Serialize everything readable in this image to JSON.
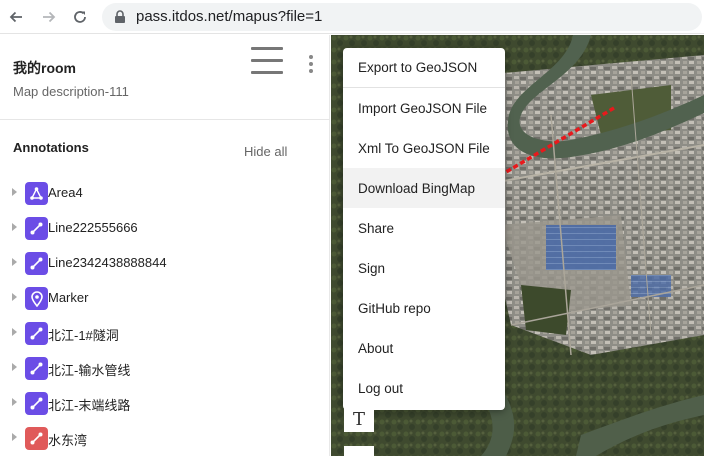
{
  "browser": {
    "url": "pass.itdos.net/mapus?file=1"
  },
  "project": {
    "title": "我的room",
    "description": "Map description-111"
  },
  "annotations": {
    "heading": "Annotations",
    "hide_all_label": "Hide all",
    "items": [
      {
        "label": "Area4",
        "type": "area",
        "color": "#6b4de6"
      },
      {
        "label": "Line222555666",
        "type": "line",
        "color": "#6b4de6"
      },
      {
        "label": "Line2342438888844",
        "type": "line",
        "color": "#6b4de6"
      },
      {
        "label": "Marker",
        "type": "marker",
        "color": "#6b4de6"
      },
      {
        "label": "北江-1#隧洞",
        "type": "line",
        "color": "#6b4de6"
      },
      {
        "label": "北江-输水管线",
        "type": "line",
        "color": "#6b4de6"
      },
      {
        "label": "北江-末端线路",
        "type": "line",
        "color": "#6b4de6"
      },
      {
        "label": "水东湾",
        "type": "line",
        "color": "#e05a5a"
      }
    ]
  },
  "menu": {
    "items": [
      {
        "label": "Export to GeoJSON"
      },
      {
        "label": "Import GeoJSON File"
      },
      {
        "label": "Xml To GeoJSON File"
      },
      {
        "label": "Download BingMap"
      },
      {
        "label": "Share"
      },
      {
        "label": "Sign"
      },
      {
        "label": "GitHub repo"
      },
      {
        "label": "About"
      },
      {
        "label": "Log out"
      }
    ]
  },
  "map_tools": {
    "text_tool_glyph": "T"
  },
  "colors": {
    "accent_purple": "#6b4de6",
    "accent_red": "#e05a5a",
    "arrow_red": "#e8191c"
  }
}
